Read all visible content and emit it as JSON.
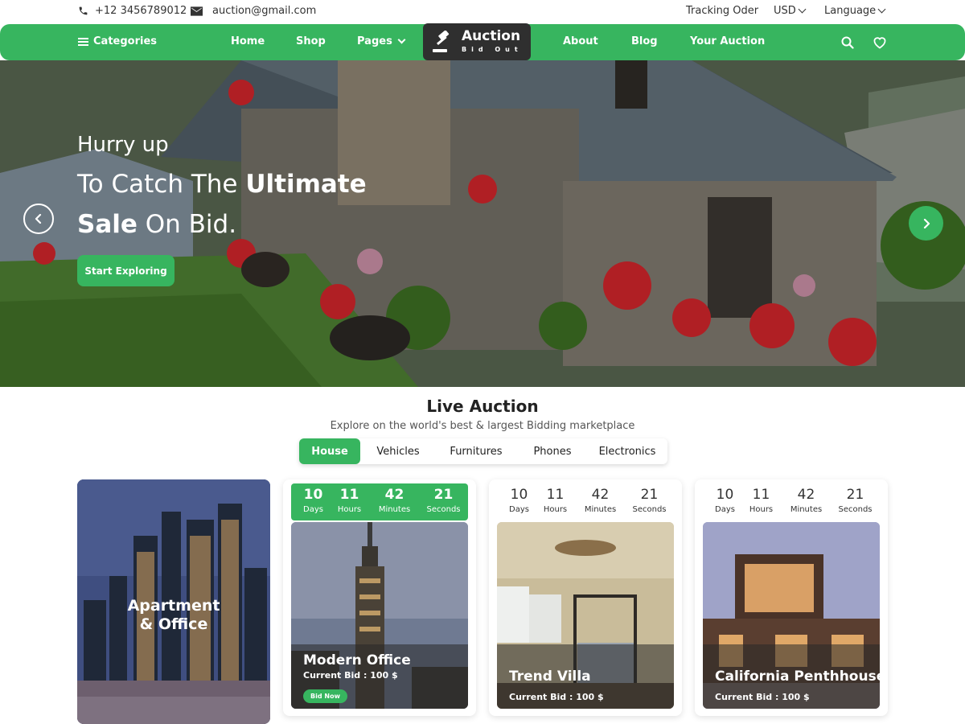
{
  "topbar": {
    "phone": "+12 3456789012",
    "email": "auction@gmail.com",
    "tracking": "Tracking Oder",
    "currency": "USD",
    "language": "Language"
  },
  "nav": {
    "categories": "Categories",
    "links": [
      "Home",
      "Shop",
      "Pages",
      "About",
      "Blog",
      "Your Auction"
    ],
    "logo": {
      "brand": "Auction",
      "tagline": "Bid Out"
    }
  },
  "hero": {
    "line1": "Hurry up",
    "line2_pre": "To Catch The ",
    "line2_bold": "Ultimate",
    "line3_bold": "Sale",
    "line3_post": " On Bid.",
    "button": "Start Exploring"
  },
  "live_auction": {
    "title": "Live Auction",
    "subtitle": "Explore on the world's best & largest Bidding marketplace",
    "tabs": [
      "House",
      "Vehicles",
      "Furnitures",
      "Phones",
      "Electronics"
    ],
    "active_tab": "House"
  },
  "feature": {
    "line1": "Apartment",
    "line2": "& Office"
  },
  "countdown": {
    "days": "10",
    "hours": "11",
    "minutes": "42",
    "seconds": "21",
    "labels": {
      "days": "Days",
      "hours": "Hours",
      "minutes": "Minutes",
      "seconds": "Seconds"
    }
  },
  "cards": [
    {
      "name": "Modern  Office",
      "bid": "Current Bid : 100 $",
      "button": "Bid Now"
    },
    {
      "name": "Trend Villa",
      "bid": "Current Bid : 100 $"
    },
    {
      "name": "California Penthhouse",
      "bid": "Current Bid : 100 $"
    }
  ],
  "colors": {
    "accent": "#37b55f",
    "dark": "#2f2f2f"
  },
  "icons": [
    "phone-icon",
    "mail-icon",
    "menu-icon",
    "gavel-icon",
    "search-icon",
    "heart-icon",
    "arrow-left-icon",
    "arrow-right-icon"
  ]
}
